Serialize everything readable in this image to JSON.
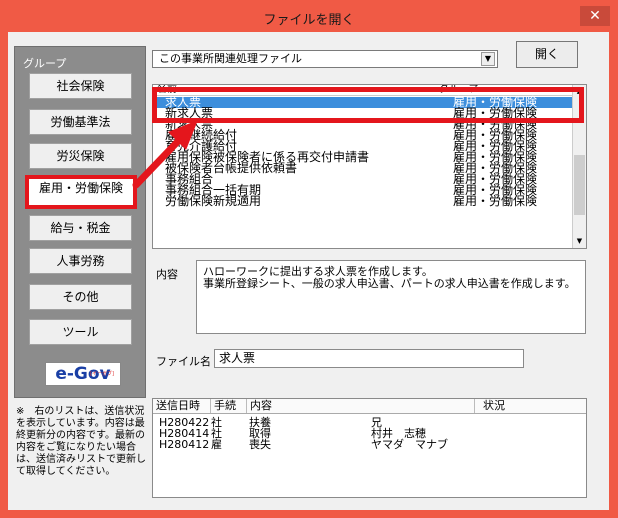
{
  "window": {
    "title": "ファイルを開く",
    "close_glyph": "✕"
  },
  "groups": {
    "label": "グループ",
    "items": [
      "社会保険",
      "労働基準法",
      "労災保険",
      "雇用・労働保険",
      "給与・税金",
      "人事労務",
      "その他",
      "ツール"
    ],
    "active_index": 3
  },
  "logo": {
    "text": "e-Gov",
    "small": "[イーガブ]"
  },
  "note": "※　右のリストは、送信状況を表示しています。内容は最終更新分の内容です。最新の内容をご覧になりたい場合は、送信済みリストで更新して取得してください。",
  "file_select": {
    "value": "この事業所関連処理ファイル",
    "arrow": "▼"
  },
  "open_button": "開く",
  "list": {
    "headers": {
      "name": "名前",
      "group": "グループ"
    },
    "rows": [
      {
        "name": "求人票",
        "group": "雇用・労働保険"
      },
      {
        "name": "新求人票",
        "group": "雇用・労働保険"
      },
      {
        "name": "新求人票",
        "group": "雇用・労働保険"
      },
      {
        "name": "雇用継続給付",
        "group": "雇用・労働保険"
      },
      {
        "name": "育児介護給付",
        "group": "雇用・労働保険"
      },
      {
        "name": "雇用保険被保険者に係る再交付申請書",
        "group": "雇用・労働保険"
      },
      {
        "name": "被保険者台帳提供依頼書",
        "group": "雇用・労働保険"
      },
      {
        "name": "事務組合",
        "group": "雇用・労働保険"
      },
      {
        "name": "事務組合一括有期",
        "group": "雇用・労働保険"
      },
      {
        "name": "労働保険新規適用",
        "group": "雇用・労働保険"
      }
    ],
    "selected_index": 0,
    "scroll_up": "▲",
    "scroll_down": "▼"
  },
  "description": {
    "label": "内容",
    "lines": [
      "ハローワークに提出する求人票を作成します。",
      "事業所登録シート、一般の求人申込書、パートの求人申込書を作成します。"
    ]
  },
  "filename": {
    "label": "ファイル名",
    "value": "求人票"
  },
  "history": {
    "headers": [
      "送信日時",
      "手続",
      "内容",
      "状況"
    ],
    "rows": [
      {
        "date": "H280422",
        "proc": "社",
        "content": "扶養",
        "name": "兄"
      },
      {
        "date": "H280414",
        "proc": "社",
        "content": "取得",
        "name": "村井　志穂"
      },
      {
        "date": "H280412",
        "proc": "雇",
        "content": "喪失",
        "name": "ヤマダ　マナブ"
      }
    ]
  },
  "colors": {
    "highlight": "#e4161c",
    "selection": "#3c8edc",
    "titlebar": "#f05a45"
  }
}
